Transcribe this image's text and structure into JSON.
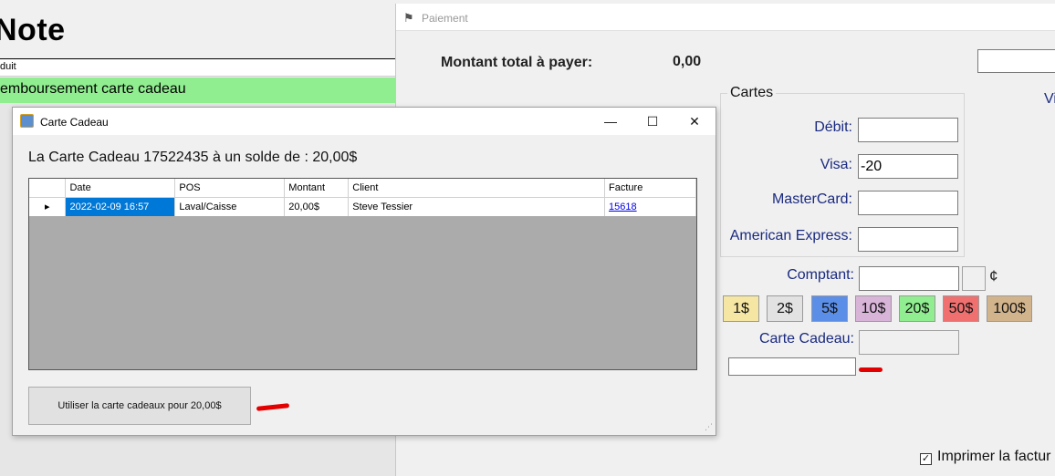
{
  "note": {
    "title": "Note",
    "header_col": "duit",
    "row_text": "emboursement carte cadeau"
  },
  "payment": {
    "window_title": "Paiement",
    "total_label": "Montant total à payer:",
    "total_value": "0,00",
    "side_link": "Vi",
    "cards_group_title": "Cartes",
    "fields": {
      "debit": {
        "label": "Débit:",
        "value": ""
      },
      "visa": {
        "label": "Visa:",
        "value": "-20"
      },
      "mastercard": {
        "label": "MasterCard:",
        "value": ""
      },
      "amex": {
        "label": "American Express:",
        "value": ""
      },
      "cash": {
        "label": "Comptant:",
        "value": ""
      },
      "giftcard": {
        "label": "Carte Cadeau:",
        "value": ""
      }
    },
    "cents_symbol": "¢",
    "bills": [
      {
        "label": "1$",
        "color": "#f5e6a3"
      },
      {
        "label": "2$",
        "color": "#e2e2e2"
      },
      {
        "label": "5$",
        "color": "#5b8ee6"
      },
      {
        "label": "10$",
        "color": "#d8b4d8"
      },
      {
        "label": "20$",
        "color": "#90ee90"
      },
      {
        "label": "50$",
        "color": "#f07070"
      },
      {
        "label": "100$",
        "color": "#d2b48c"
      }
    ],
    "print_label": "Imprimer la factur",
    "print_checked": true
  },
  "giftcard_dialog": {
    "title": "Carte Cadeau",
    "icon": "gift-card-icon",
    "window_controls": {
      "minimize": "—",
      "maximize": "☐",
      "close": "✕"
    },
    "balance_text": "La Carte Cadeau 17522435 à un solde de : 20,00$",
    "table": {
      "columns": [
        "Date",
        "POS",
        "Montant",
        "Client",
        "Facture"
      ],
      "rows": [
        {
          "Date": "2022-02-09 16:57",
          "POS": "Laval/Caisse",
          "Montant": "20,00$",
          "Client": "Steve Tessier",
          "Facture": "15618"
        }
      ]
    },
    "use_button": "Utiliser la carte cadeaux pour 20,00$"
  },
  "accent_colors": {
    "annotation": "#e30000",
    "selection": "#0078d7",
    "label": "#1a2a80"
  }
}
